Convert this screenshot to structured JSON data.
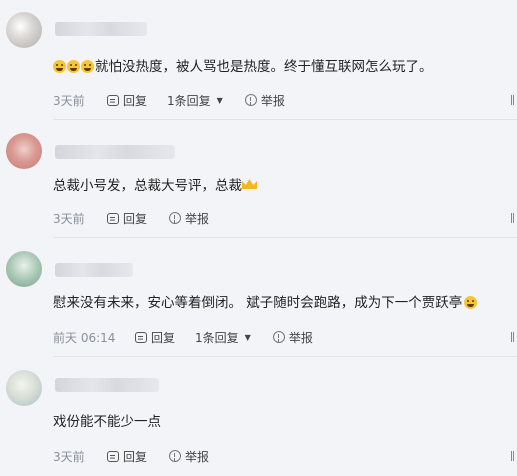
{
  "comments": [
    {
      "text": "就怕没热度，被人骂也是热度。终于懂互联网怎么玩了。",
      "prefix_emoji": "laugh-cry-emoji",
      "time": "3天前",
      "reply_label": "回复",
      "reply_count": "1条回复",
      "report_label": "举报"
    },
    {
      "text": "总裁小号发，总裁大号评，总裁",
      "suffix_emoji": "crown-emoji",
      "time": "3天前",
      "reply_label": "回复",
      "report_label": "举报"
    },
    {
      "text": "慰来没有未来，安心等着倒闭。 斌子随时会跑路，成为下一个贾跃亭",
      "suffix_emoji": "thinking-emoji",
      "time": "前天 06:14",
      "reply_label": "回复",
      "reply_count": "1条回复",
      "report_label": "举报"
    },
    {
      "text": "戏份能不能少一点",
      "time": "3天前",
      "reply_label": "回复",
      "report_label": "举报"
    }
  ],
  "colors": {
    "background": "#f3f4f8",
    "meta_text": "#8a8f99"
  }
}
